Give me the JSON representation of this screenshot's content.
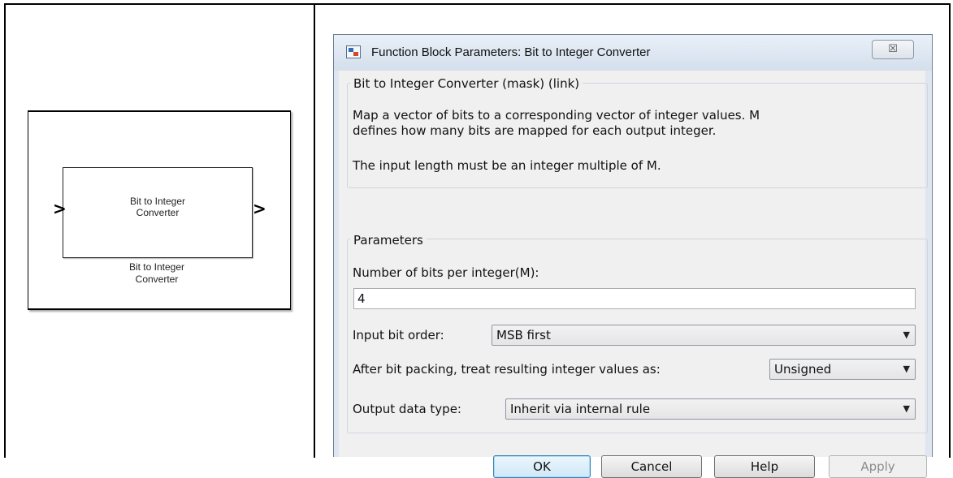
{
  "diagram": {
    "block_label_line1": "Bit to Integer",
    "block_label_line2": "Converter",
    "caption_line1": "Bit to Integer",
    "caption_line2": "Converter",
    "port_glyph": ">"
  },
  "dialog": {
    "title": "Function Block Parameters: Bit to Integer Converter",
    "close_glyph": "☒",
    "mask_group": {
      "legend": "Bit to Integer Converter (mask) (link)",
      "desc_line1": "Map a vector of bits to a corresponding vector of integer values. M",
      "desc_line2": "defines how many bits are mapped for each output integer.",
      "desc_line3": "The input length must be an integer multiple of M."
    },
    "params": {
      "legend": "Parameters",
      "bits_label": "Number of bits per integer(M):",
      "bits_value": "4",
      "order_label": "Input bit order:",
      "order_value": "MSB first",
      "pack_label": "After bit packing, treat resulting integer values as:",
      "pack_value": "Unsigned",
      "out_label": "Output data type:",
      "out_value": "Inherit via internal rule"
    },
    "buttons": {
      "ok": "OK",
      "cancel": "Cancel",
      "help": "Help",
      "apply": "Apply"
    }
  },
  "icons": {
    "dropdown": "chevron-down-icon",
    "close": "close-icon",
    "app": "simulink-icon"
  },
  "colors": {
    "ok_border": "#3c7fb1",
    "dialog_frame": "#dfe6ef"
  }
}
